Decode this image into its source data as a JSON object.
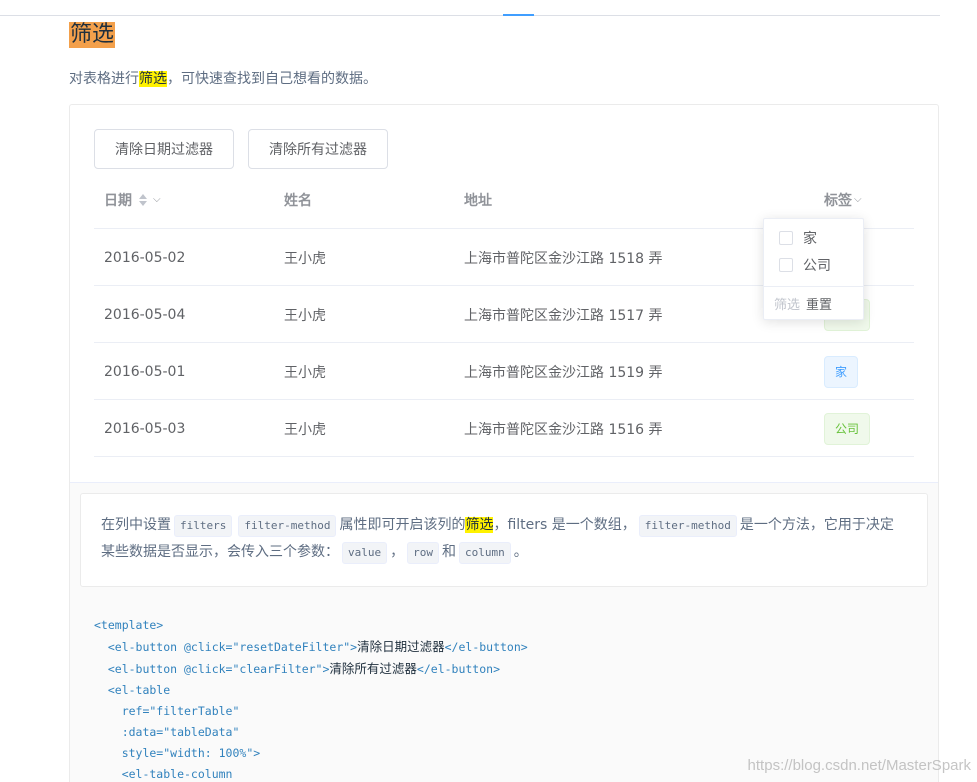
{
  "page": {
    "title": "筛选",
    "intro_before": "对表格进行",
    "intro_highlight": "筛选",
    "intro_after": "，可快速查找到自己想看的数据。"
  },
  "buttons": {
    "clear_date_filter": "清除日期过滤器",
    "clear_all_filters": "清除所有过滤器"
  },
  "table": {
    "headers": {
      "date": "日期",
      "name": "姓名",
      "address": "地址",
      "tag": "标签"
    },
    "rows": [
      {
        "date": "2016-05-02",
        "name": "王小虎",
        "address": "上海市普陀区金沙江路 1518 弄",
        "tag": ""
      },
      {
        "date": "2016-05-04",
        "name": "王小虎",
        "address": "上海市普陀区金沙江路 1517 弄",
        "tag": ""
      },
      {
        "date": "2016-05-01",
        "name": "王小虎",
        "address": "上海市普陀区金沙江路 1519 弄",
        "tag": "家"
      },
      {
        "date": "2016-05-03",
        "name": "王小虎",
        "address": "上海市普陀区金沙江路 1516 弄",
        "tag": "公司"
      }
    ]
  },
  "filter_dropdown": {
    "options": [
      "家",
      "公司"
    ],
    "confirm_label": "筛选",
    "reset_label": "重置"
  },
  "description": {
    "p1": "在列中设置",
    "chip_filters": "filters",
    "chip_filter_method": "filter-method",
    "p2": "属性即可开启该列的",
    "highlight": "筛选",
    "p3": "，filters 是一个数组，",
    "chip_filter_method_2": "filter-method",
    "p4": "是一个方法，它用于决定某些数据是否显示，会传入三个参数：",
    "chip_value": "value",
    "p5": "，",
    "chip_row": "row",
    "p6": "和",
    "chip_column": "column",
    "p7": "。"
  },
  "code": {
    "line1": "<template>",
    "line2_pre": "  <el-button @click=\"resetDateFilter\">",
    "line2_text": "清除日期过滤器",
    "line2_post": "</el-button>",
    "line3_pre": "  <el-button @click=\"clearFilter\">",
    "line3_text": "清除所有过滤器",
    "line3_post": "</el-button>",
    "line4": "  <el-table",
    "line5": "    ref=\"filterTable\"",
    "line6": "    :data=\"tableData\"",
    "line7": "    style=\"width: 100%\">",
    "line8": "    <el-table-column"
  },
  "watermark": "https://blog.csdn.net/MasterSpark"
}
